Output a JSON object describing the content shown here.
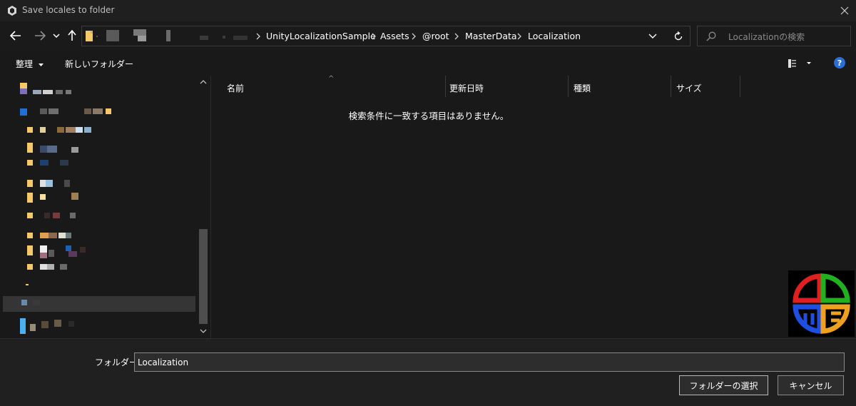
{
  "window": {
    "title": "Save locales to folder",
    "close_glyph": "✕"
  },
  "nav": {
    "back_icon": "arrow-left-icon",
    "forward_icon": "arrow-right-icon",
    "recent_icon": "chevron-down-icon",
    "up_icon": "arrow-up-icon",
    "breadcrumbs": [
      "UnityLocalizationSample",
      "Assets",
      "@root",
      "MasterData",
      "Localization"
    ],
    "search_placeholder": "Localizationの検索"
  },
  "toolbar": {
    "organize_label": "整理",
    "new_folder_label": "新しいフォルダー",
    "help_label": "?"
  },
  "columns": [
    "名前",
    "更新日時",
    "種類",
    "サイズ"
  ],
  "empty_message": "検索条件に一致する項目はありません。",
  "footer": {
    "folder_label": "フォルダー:",
    "folder_value": "Localization",
    "select_button": "フォルダーの選択",
    "cancel_button": "キャンセル"
  },
  "colors": {
    "background": "#191919",
    "accent_help": "#2b6fd6",
    "folder_yellow": "#f5c86a",
    "logo_red": "#e02020",
    "logo_green": "#20b020",
    "logo_blue": "#1f4fe0",
    "logo_orange": "#f0a020"
  }
}
